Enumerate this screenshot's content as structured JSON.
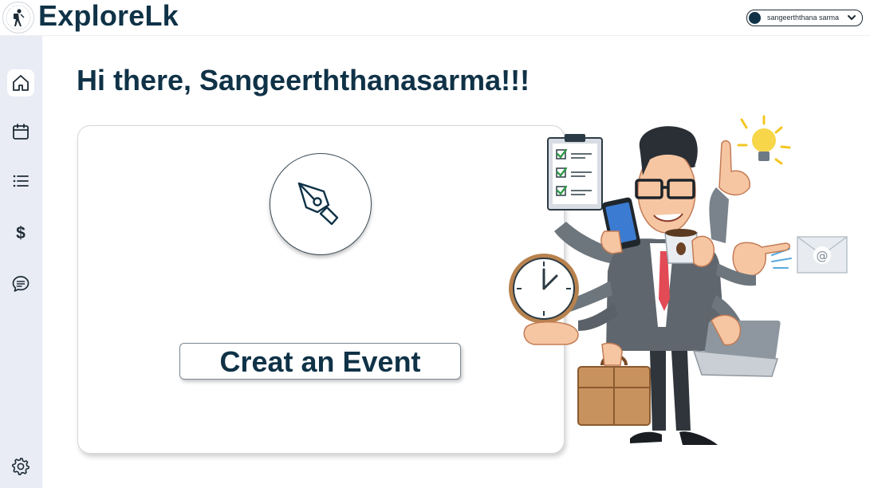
{
  "app": {
    "brand": "ExploreLk",
    "logo_text": "EXPLORE LK",
    "accent_color": "#0f3247",
    "sidebar_color": "#e9ecf5"
  },
  "header": {
    "user_name": "sangeerththana sarma",
    "avatar_icon": "user-avatar-dot",
    "dropdown_icon": "chevron-down-icon"
  },
  "sidebar": {
    "items": [
      {
        "name": "home",
        "icon": "home-icon",
        "active": true
      },
      {
        "name": "calendar",
        "icon": "calendar-icon",
        "active": false
      },
      {
        "name": "list",
        "icon": "list-icon",
        "active": false
      },
      {
        "name": "payments",
        "icon": "dollar-icon",
        "active": false
      },
      {
        "name": "messages",
        "icon": "chat-icon",
        "active": false
      },
      {
        "name": "settings",
        "icon": "gear-icon",
        "active": false
      }
    ]
  },
  "main": {
    "greeting": "Hi there, Sangeerththanasarma!!!",
    "card": {
      "icon": "pen-nib-icon",
      "button_label": "Creat an Event"
    },
    "illustration": "multitasking-businessman-illustration"
  }
}
